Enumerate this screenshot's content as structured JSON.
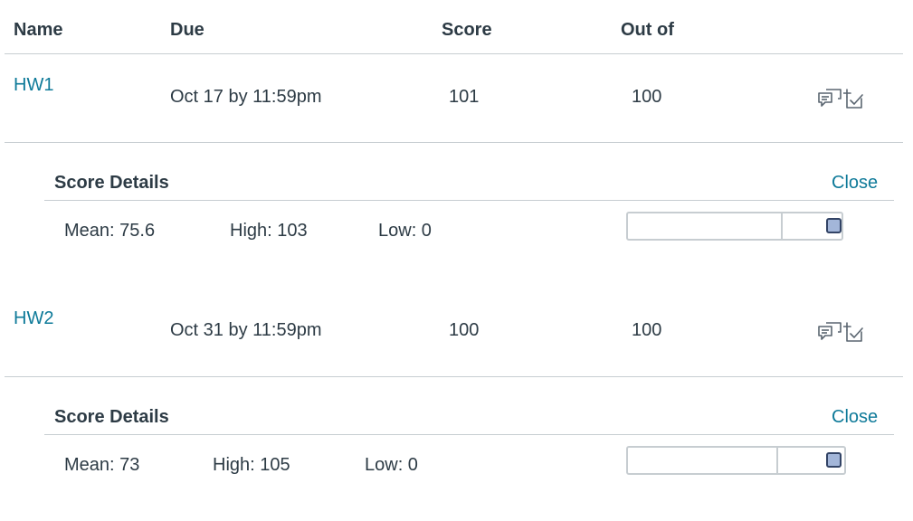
{
  "table": {
    "headers": {
      "name": "Name",
      "due": "Due",
      "score": "Score",
      "out_of": "Out of"
    }
  },
  "assignments": [
    {
      "name": "HW1",
      "due": "Oct 17 by 11:59pm",
      "score": "101",
      "out_of": "100",
      "details": {
        "title": "Score Details",
        "close_label": "Close",
        "mean": "Mean: 75.6",
        "high": "High: 103",
        "low": "Low: 0",
        "score_fraction": 0.98
      }
    },
    {
      "name": "HW2",
      "due": "Oct 31 by 11:59pm",
      "score": "100",
      "out_of": "100",
      "details": {
        "title": "Score Details",
        "close_label": "Close",
        "mean": "Mean: 73",
        "high": "High: 105",
        "low": "Low: 0",
        "score_fraction": 0.95
      }
    }
  ],
  "icons": {
    "comment": "comment-icon",
    "rubric": "rubric-checklist-icon"
  },
  "colors": {
    "link": "#0e7a99",
    "text": "#2d3b45",
    "divider": "#c7cdd1",
    "marker_fill": "#a3b6d9",
    "marker_border": "#334466"
  }
}
